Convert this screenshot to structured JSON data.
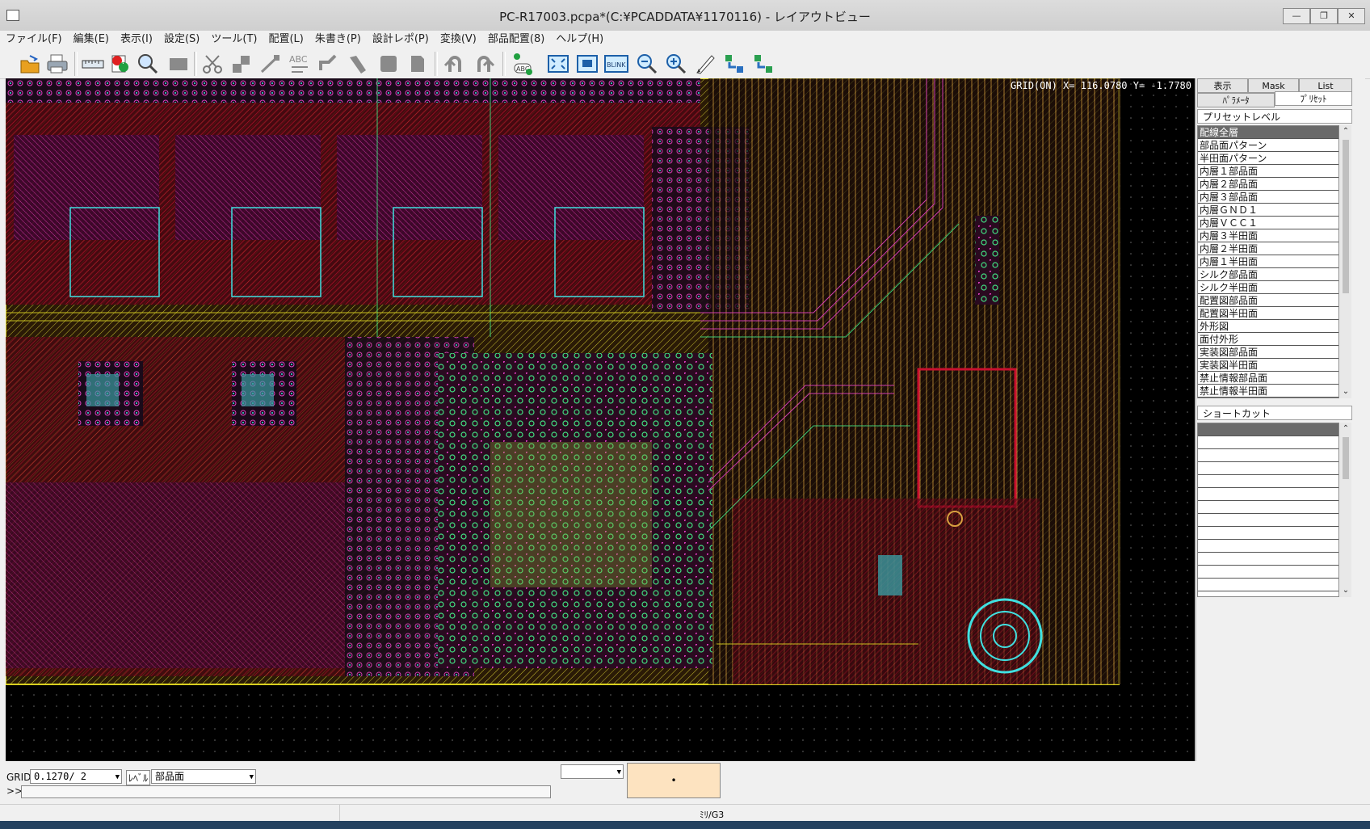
{
  "window": {
    "title": "PC-R17003.pcpa*(C:¥PCADDATA¥1170116) - レイアウトビュー",
    "controls": [
      "minimize-icon",
      "maximize-icon",
      "close-icon"
    ]
  },
  "menu": [
    "ファイル(F)",
    "編集(E)",
    "表示(I)",
    "設定(S)",
    "ツール(T)",
    "配置(L)",
    "朱書き(P)",
    "設計レポ(P)",
    "変換(V)",
    "部品配置(8)",
    "ヘルプ(H)"
  ],
  "toolbar": {
    "icons": [
      "open-icon",
      "print-icon",
      "ruler-icon",
      "layers-icon",
      "search-icon",
      "blank-icon",
      "cut-icon",
      "move-icon",
      "wire-icon",
      "text-icon",
      "route-icon",
      "pad-icon",
      "pad2-icon",
      "page-icon",
      "undo-icon",
      "redo-icon",
      "abc-icon",
      "fit-icon",
      "zoom-area-icon",
      "blink-icon",
      "zoom-out-icon",
      "zoom-in-icon",
      "pen-icon",
      "link-icon",
      "unlink-icon"
    ],
    "blink_label": "BLINK",
    "abc_label": "ABC"
  },
  "canvas": {
    "coord_readout": "GRID(ON) X= 116.0780 Y=  -1.7780"
  },
  "colors": {
    "board_bg": "#000000",
    "trace_red": "#c8102e",
    "trace_magenta": "#e040c0",
    "trace_green": "#40e080",
    "trace_yellow": "#f0e040",
    "trace_cyan": "#40e0e0",
    "board_outline": "#d8d020"
  },
  "panel": {
    "tabs_top": [
      "表示",
      "Mask",
      "List"
    ],
    "tabs_second": [
      "ﾊﾟﾗﾒｰﾀ",
      "ﾌﾟﾘｾｯﾄ"
    ],
    "active_tab": "ﾌﾟﾘｾｯﾄ",
    "preset_title": "プリセットレベル",
    "preset_items": [
      "配線全層",
      "部品面パターン",
      "半田面パターン",
      "内層１部品面",
      "内層２部品面",
      "内層３部品面",
      "内層ＧＮＤ１",
      "内層ＶＣＣ１",
      "内層３半田面",
      "内層２半田面",
      "内層１半田面",
      "シルク部品面",
      "シルク半田面",
      "配置図部品面",
      "配置図半田面",
      "外形図",
      "面付外形",
      "実装図部品面",
      "実装図半田面",
      "禁止情報部品面",
      "禁止情報半田面"
    ],
    "preset_selected_index": 0,
    "shortcut_title": "ショートカット",
    "shortcut_rows": 13
  },
  "bottom": {
    "grid_label": "GRID",
    "grid_value": "0.1270/ 2",
    "level_label": "ﾚﾍﾞﾙ",
    "level_value": "部品面",
    "prompt": ">>",
    "dot_char": "•"
  },
  "status": {
    "unit": "ﾐﾘ/G3"
  }
}
